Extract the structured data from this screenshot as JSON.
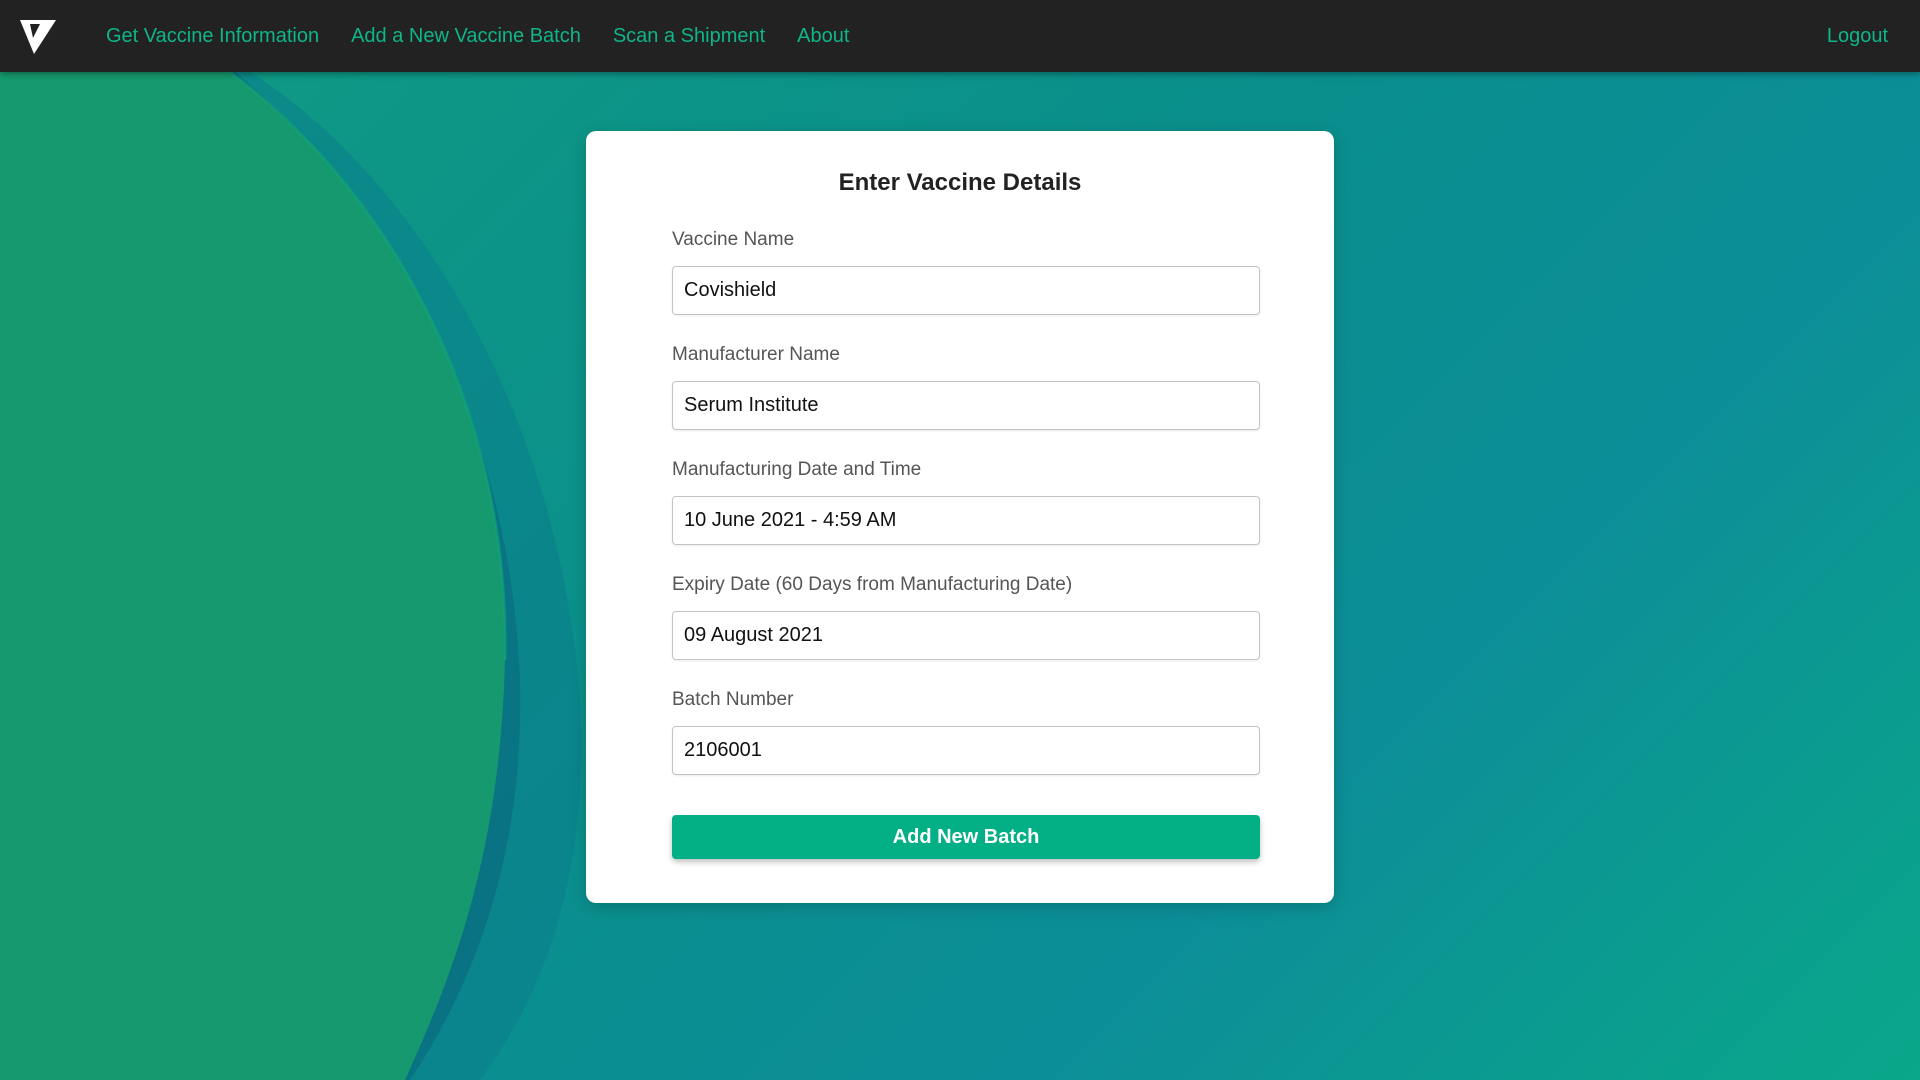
{
  "navbar": {
    "logo_icon": "v-logo-icon",
    "links": [
      "Get Vaccine Information",
      "Add a New Vaccine Batch",
      "Scan a Shipment",
      "About"
    ],
    "logout_label": "Logout",
    "link_color": "#0fb589",
    "background": "#222222"
  },
  "form": {
    "title": "Enter Vaccine Details",
    "fields": [
      {
        "label": "Vaccine Name",
        "value": "Covishield"
      },
      {
        "label": "Manufacturer Name",
        "value": "Serum Institute"
      },
      {
        "label": "Manufacturing Date and Time",
        "value": "10 June 2021 - 4:59 AM"
      },
      {
        "label": "Expiry Date (60 Days from Manufacturing Date)",
        "value": "09 August 2021"
      },
      {
        "label": "Batch Number",
        "value": "2106001"
      }
    ],
    "submit_label": "Add New Batch",
    "submit_color": "#03b086"
  }
}
